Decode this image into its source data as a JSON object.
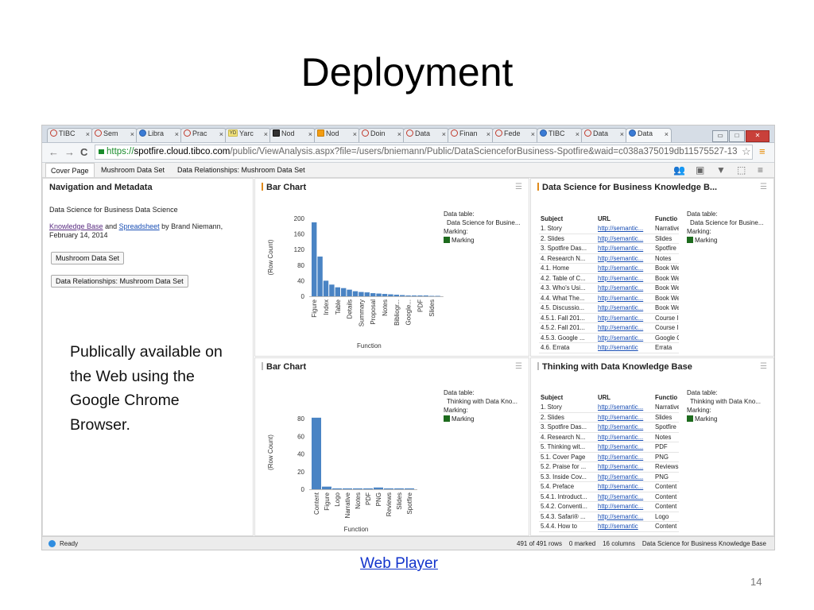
{
  "slide": {
    "title": "Deployment",
    "note": "Publically available on the Web using the Google Chrome Browser.",
    "link": "Web Player",
    "page_number": "14"
  },
  "browser": {
    "tabs": [
      "TIBC",
      "Sem",
      "Libra",
      "Prac",
      "Yarc",
      "Nod",
      "Nod",
      "Doin",
      "Data",
      "Finan",
      "Fede",
      "TIBC",
      "Data",
      "Data"
    ],
    "tab_icons": [
      "spotfire-icon",
      "spotfire-icon",
      "blue-globe-icon",
      "spotfire-icon",
      "yd-icon",
      "dark-square-icon",
      "orange-square-icon",
      "spotfire-icon",
      "spotfire-icon",
      "spotfire-icon",
      "spotfire-icon",
      "blue-globe-icon",
      "spotfire-icon",
      "blue-globe-icon"
    ],
    "url_scheme": "https://",
    "url_host": "spotfire.cloud.tibco.com",
    "url_path": "/public/ViewAnalysis.aspx?file=/users/bniemann/Public/DataScienceforBusiness-Spotfire&waid=c038a375019db11575527-13",
    "back": "←",
    "forward": "→",
    "reload": "C",
    "star": "☆",
    "menu": "≡",
    "window_buttons": [
      "▭",
      "□",
      "✕"
    ]
  },
  "app": {
    "page_tabs": [
      "Cover Page",
      "Mushroom Data Set",
      "Data Relationships: Mushroom Data Set"
    ],
    "active_page_tab": 0,
    "toolbar_icons": [
      "bookmark-people-icon",
      "bookmark-icon",
      "filter-icon",
      "expand-icon",
      "menu-icon"
    ],
    "nav_panel": {
      "title": "Navigation and Metadata",
      "subtitle": "Data Science for Business Data Science",
      "link1": "Knowledge Base",
      "and": " and ",
      "link2": "Spreadsheet",
      "byline": " by Brand Niemann,",
      "date": "February 14, 2014",
      "button1": "Mushroom Data Set",
      "button2": "Data Relationships: Mushroom Data Set"
    },
    "legend_labels": {
      "table": "Data table:",
      "marking": "Marking:",
      "marking_value": "Marking"
    },
    "table_headers": [
      "Subject",
      "URL",
      "Functio"
    ],
    "kb1": {
      "title": "Data Science for Business Knowledge B...",
      "legend_table": "Data Science for Busine...",
      "rows": [
        [
          "1. Story",
          "http://semantic...",
          "Narrative"
        ],
        [
          "2. Slides",
          "http://semantic...",
          "Slides"
        ],
        [
          "3. Spotfire Das...",
          "http://semantic...",
          "Spotfire"
        ],
        [
          "4. Research N...",
          "http://semantic...",
          "Notes"
        ],
        [
          "4.1. Home",
          "http://semantic...",
          "Book We"
        ],
        [
          "4.2. Table of C...",
          "http://semantic...",
          "Book We"
        ],
        [
          "4.3. Who's Usi...",
          "http://semantic...",
          "Book We"
        ],
        [
          "4.4. What The...",
          "http://semantic...",
          "Book We"
        ],
        [
          "4.5. Discussio...",
          "http://semantic...",
          "Book We"
        ],
        [
          "4.5.1. Fall 201...",
          "http://semantic...",
          "Course I"
        ],
        [
          "4.5.2. Fall 201...",
          "http://semantic...",
          "Course I"
        ],
        [
          "4.5.3. Google ...",
          "http://semantic...",
          "Google C"
        ],
        [
          "4.6. Errata",
          "http://semantic",
          "Errata"
        ]
      ]
    },
    "kb2": {
      "title": "Thinking with Data Knowledge Base",
      "legend_table": "Thinking with Data Kno...",
      "rows": [
        [
          "1. Story",
          "http://semantic...",
          "Narrative"
        ],
        [
          "2. Slides",
          "http://semantic...",
          "Slides"
        ],
        [
          "3. Spotfire Das...",
          "http://semantic...",
          "Spotfire"
        ],
        [
          "4. Research N...",
          "http://semantic...",
          "Notes"
        ],
        [
          "5. Thinking wit...",
          "http://semantic...",
          "PDF"
        ],
        [
          "5.1. Cover Page",
          "http://semantic...",
          "PNG"
        ],
        [
          "5.2. Praise for ...",
          "http://semantic...",
          "Reviews"
        ],
        [
          "5.3. Inside Cov...",
          "http://semantic...",
          "PNG"
        ],
        [
          "5.4. Preface",
          "http://semantic...",
          "Content"
        ],
        [
          "5.4.1. Introduct...",
          "http://semantic...",
          "Content"
        ],
        [
          "5.4.2. Conventi...",
          "http://semantic...",
          "Content"
        ],
        [
          "5.4.3. Safari® ...",
          "http://semantic...",
          "Logo"
        ],
        [
          "5.4.4. How to",
          "http://semantic",
          "Content"
        ]
      ]
    },
    "status": {
      "ready": "Ready",
      "rows": "491 of 491 rows",
      "marked": "0 marked",
      "columns": "16 columns",
      "table": "Data Science for Business Knowledge Base"
    }
  },
  "chart_data": [
    {
      "type": "bar",
      "title": "Bar Chart",
      "xlabel": "Function",
      "ylabel": "(Row Count)",
      "ylim": [
        0,
        200
      ],
      "yticks": [
        0,
        40,
        80,
        120,
        160,
        200
      ],
      "legend_table": "Data Science for Busine...",
      "categories": [
        "Figure",
        "",
        "Index",
        "",
        "Table",
        "",
        "Details",
        "",
        "Summary",
        "",
        "Proposal",
        "",
        "Notes",
        "",
        "Bibliogr...",
        "",
        "Google...",
        "",
        "PDF",
        "",
        "Slides",
        ""
      ],
      "values": [
        190,
        102,
        40,
        30,
        23,
        21,
        17,
        13,
        11,
        10,
        8,
        7,
        6,
        5,
        4,
        3,
        2,
        2,
        2,
        2,
        1,
        1
      ],
      "color": "#4a84c4"
    },
    {
      "type": "bar",
      "title": "Bar Chart",
      "xlabel": "Function",
      "ylabel": "(Row Count)",
      "ylim": [
        0,
        80
      ],
      "yticks": [
        0,
        20,
        40,
        60,
        80
      ],
      "legend_table": "Thinking with Data Kno...",
      "categories": [
        "Content",
        "Figure",
        "Logo",
        "Narrative",
        "Notes",
        "PDF",
        "PNG",
        "Reviews",
        "Slides",
        "Spotfire"
      ],
      "values": [
        81,
        3,
        1,
        1,
        1,
        1,
        2,
        1,
        1,
        1
      ],
      "color": "#4a84c4"
    }
  ]
}
